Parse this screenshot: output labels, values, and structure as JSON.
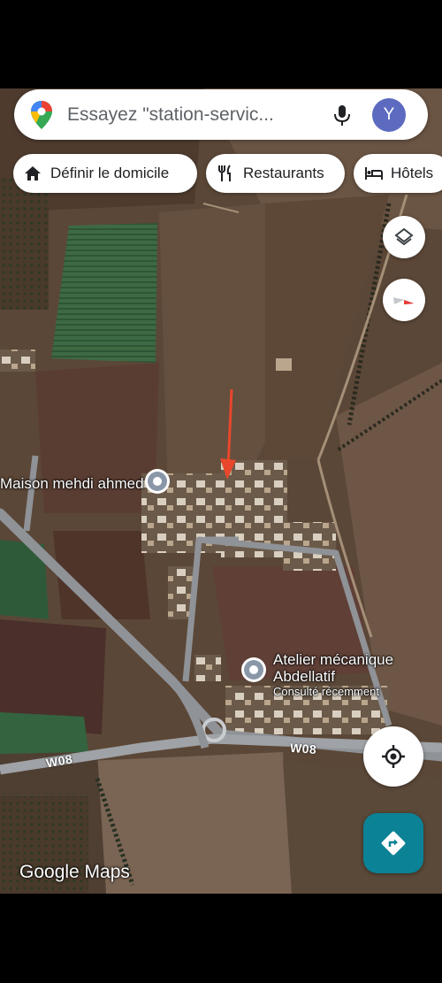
{
  "search": {
    "placeholder": "Essayez \"station-servic...",
    "avatar_letter": "Y"
  },
  "chips": [
    {
      "label": "Définir le domicile",
      "icon": "home-icon"
    },
    {
      "label": "Restaurants",
      "icon": "fork-knife-icon"
    },
    {
      "label": "Hôtels",
      "icon": "bed-icon"
    }
  ],
  "places": [
    {
      "name": "Maison mehdi ahmed"
    },
    {
      "name_line1": "Atelier mécanique",
      "name_line2": "Abdellatif",
      "subtitle": "Consulté récemment"
    }
  ],
  "roads": [
    "W08",
    "W08"
  ],
  "brand": "Google Maps",
  "controls": [
    "layers-icon",
    "compass-icon",
    "my-location-icon",
    "directions-icon"
  ],
  "colors": {
    "accent": "#1a73e8",
    "avatar": "#5c6bc0",
    "directions": "#0b8296",
    "marker_arrow": "#e8472c"
  }
}
